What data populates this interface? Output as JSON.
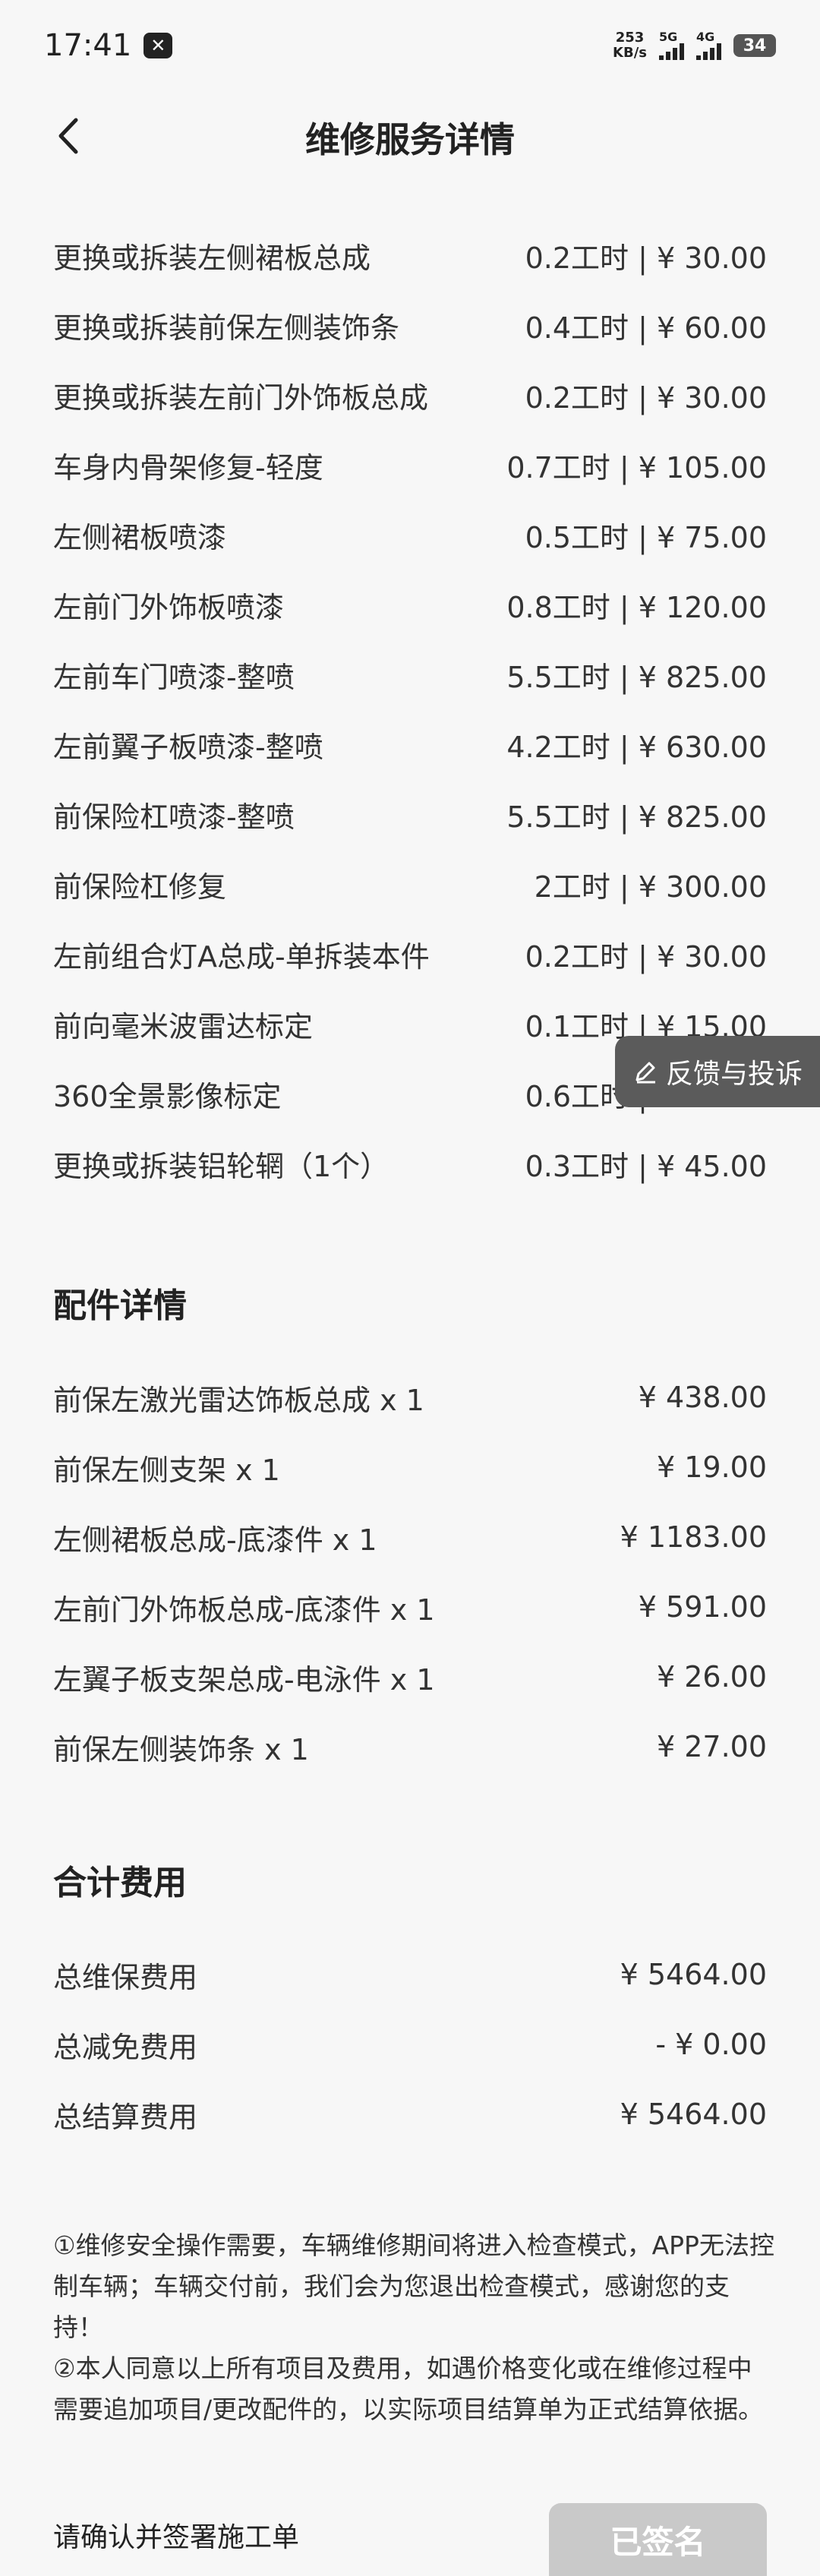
{
  "status_bar": {
    "time": "17:41",
    "net_speed_value": "253",
    "net_speed_unit": "KB/s",
    "signal_1": "5G",
    "signal_2": "4G",
    "battery": "34"
  },
  "header": {
    "title": "维修服务详情"
  },
  "services": [
    {
      "name": "更换或拆装左侧裙板总成",
      "value": "0.2工时 | ¥ 30.00"
    },
    {
      "name": "更换或拆装前保左侧装饰条",
      "value": "0.4工时 | ¥ 60.00"
    },
    {
      "name": "更换或拆装左前门外饰板总成",
      "value": "0.2工时 | ¥ 30.00"
    },
    {
      "name": "车身内骨架修复-轻度",
      "value": "0.7工时 | ¥ 105.00"
    },
    {
      "name": "左侧裙板喷漆",
      "value": "0.5工时 | ¥ 75.00"
    },
    {
      "name": "左前门外饰板喷漆",
      "value": "0.8工时 | ¥ 120.00"
    },
    {
      "name": "左前车门喷漆-整喷",
      "value": "5.5工时 | ¥ 825.00"
    },
    {
      "name": "左前翼子板喷漆-整喷",
      "value": "4.2工时 | ¥ 630.00"
    },
    {
      "name": "前保险杠喷漆-整喷",
      "value": "5.5工时 | ¥ 825.00"
    },
    {
      "name": "前保险杠修复",
      "value": "2工时 | ¥ 300.00"
    },
    {
      "name": "左前组合灯A总成-单拆装本件",
      "value": "0.2工时 | ¥ 30.00"
    },
    {
      "name": "前向毫米波雷达标定",
      "value": "0.1工时 | ¥ 15.00"
    },
    {
      "name": "360全景影像标定",
      "value": "0.6工时 | ¥ 90.00"
    },
    {
      "name": "更换或拆装铝轮辋（1个）",
      "value": "0.3工时 | ¥ 45.00"
    }
  ],
  "parts": {
    "title": "配件详情",
    "items": [
      {
        "name": "前保左激光雷达饰板总成 x 1",
        "value": "¥ 438.00"
      },
      {
        "name": "前保左侧支架 x 1",
        "value": "¥ 19.00"
      },
      {
        "name": "左侧裙板总成-底漆件 x 1",
        "value": "¥ 1183.00"
      },
      {
        "name": "左前门外饰板总成-底漆件 x 1",
        "value": "¥ 591.00"
      },
      {
        "name": "左翼子板支架总成-电泳件 x 1",
        "value": "¥ 26.00"
      },
      {
        "name": "前保左侧装饰条 x 1",
        "value": "¥ 27.00"
      }
    ]
  },
  "totals": {
    "title": "合计费用",
    "items": [
      {
        "name": "总维保费用",
        "value": "¥ 5464.00"
      },
      {
        "name": "总减免费用",
        "value": "- ¥ 0.00"
      },
      {
        "name": "总结算费用",
        "value": "¥ 5464.00"
      }
    ]
  },
  "feedback_label": "反馈与投诉",
  "note_1": "①维修安全操作需要，车辆维修期间将进入检查模式，APP无法控制车辆；车辆交付前，我们会为您退出检查模式，感谢您的支持！",
  "note_2": "②本人同意以上所有项目及费用，如遇价格变化或在维修过程中需要追加项目/更改配件的，以实际项目结算单为正式结算依据。",
  "footer": {
    "prompt": "请确认并签署施工单",
    "button": "已签名"
  }
}
